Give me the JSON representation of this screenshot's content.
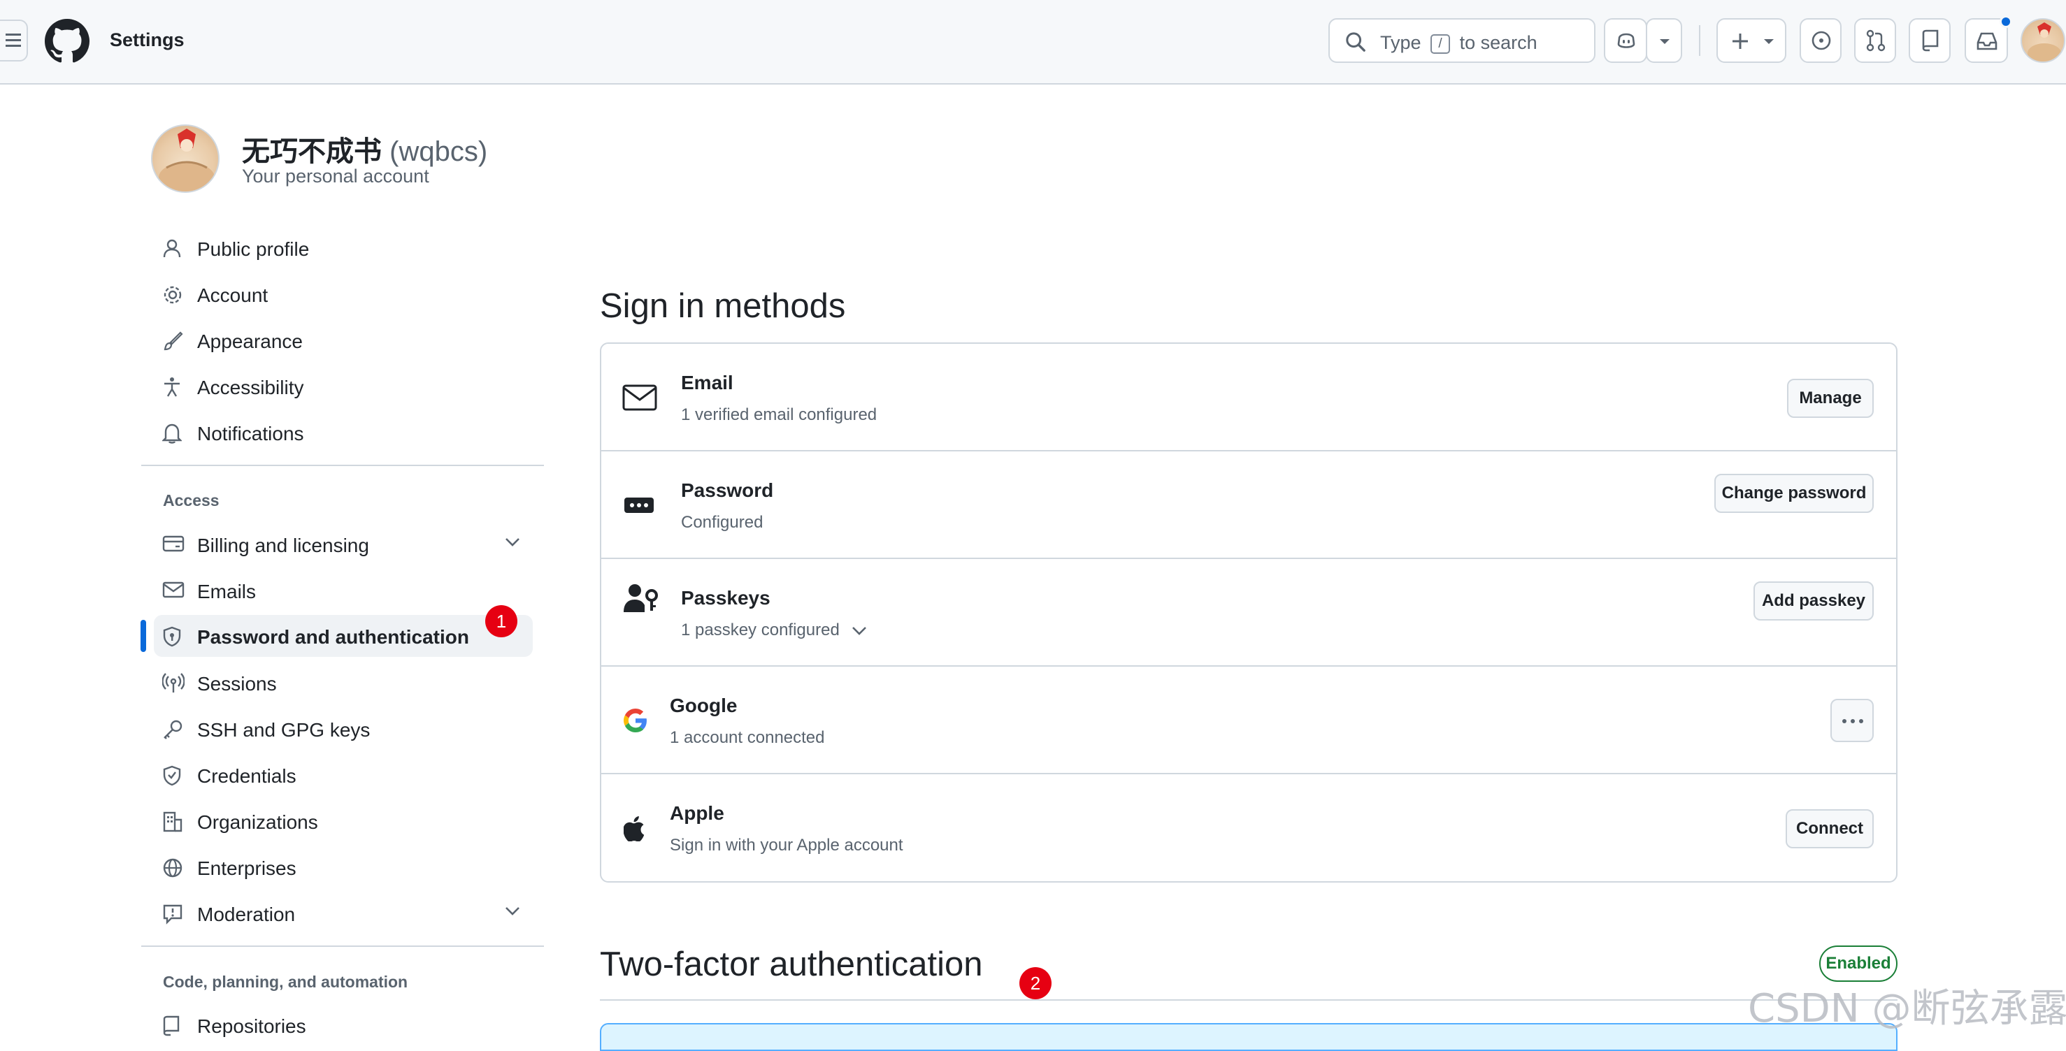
{
  "header": {
    "title": "Settings",
    "search": {
      "before": "Type",
      "key": "/",
      "after": "to search"
    }
  },
  "profile": {
    "name": "无巧不成书",
    "handle": "(wqbcs)",
    "subtitle": "Your personal account"
  },
  "sidebar": {
    "group1": [
      {
        "label": "Public profile",
        "icon": "person-icon"
      },
      {
        "label": "Account",
        "icon": "gear-icon"
      },
      {
        "label": "Appearance",
        "icon": "paintbrush-icon"
      },
      {
        "label": "Accessibility",
        "icon": "accessibility-icon"
      },
      {
        "label": "Notifications",
        "icon": "bell-icon"
      }
    ],
    "access_heading": "Access",
    "access": [
      {
        "label": "Billing and licensing",
        "icon": "credit-card-icon"
      },
      {
        "label": "Emails",
        "icon": "mail-icon"
      },
      {
        "label": "Password and authentication",
        "icon": "shield-lock-icon"
      },
      {
        "label": "Sessions",
        "icon": "broadcast-icon"
      },
      {
        "label": "SSH and GPG keys",
        "icon": "key-icon"
      },
      {
        "label": "Credentials",
        "icon": "shield-check-icon"
      },
      {
        "label": "Organizations",
        "icon": "organization-icon"
      },
      {
        "label": "Enterprises",
        "icon": "globe-icon"
      },
      {
        "label": "Moderation",
        "icon": "report-icon"
      }
    ],
    "code_heading": "Code, planning, and automation",
    "code": [
      {
        "label": "Repositories",
        "icon": "repo-icon"
      }
    ]
  },
  "annotations": {
    "one": "1",
    "two": "2"
  },
  "main": {
    "sign_in_title": "Sign in methods",
    "methods": [
      {
        "title": "Email",
        "subtitle": "1 verified email configured",
        "action": "Manage",
        "icon": "mail-icon"
      },
      {
        "title": "Password",
        "subtitle": "Configured",
        "action": "Change password",
        "icon": "password-icon"
      },
      {
        "title": "Passkeys",
        "subtitle": "1 passkey configured",
        "action": "Add passkey",
        "icon": "passkey-icon"
      },
      {
        "title": "Google",
        "subtitle": "1 account connected",
        "action": "...",
        "icon": "google-icon"
      },
      {
        "title": "Apple",
        "subtitle": "Sign in with your Apple account",
        "action": "Connect",
        "icon": "apple-icon"
      }
    ],
    "two_factor_title": "Two-factor authentication",
    "two_factor_status": "Enabled"
  },
  "watermark": "CSDN @断弦承露",
  "colors": {
    "accent": "#0969da",
    "success": "#1a7f37",
    "annotation": "#e60012"
  }
}
